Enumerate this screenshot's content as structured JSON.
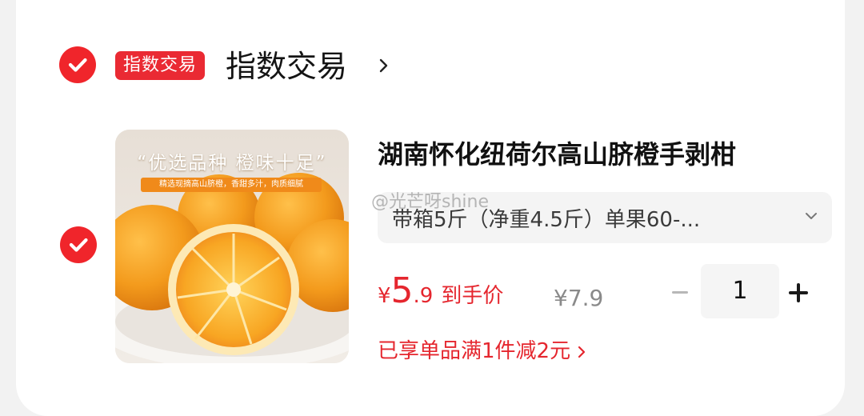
{
  "shop": {
    "tag": "指数交易",
    "name": "指数交易"
  },
  "product": {
    "title": "湖南怀化纽荷尔高山脐橙手剥柑",
    "spec": "带箱5斤（净重4.5斤）单果60-...",
    "image": {
      "headline": "“优选品种 橙味十足”",
      "subline": "精选现摘高山脐橙，香甜多汁，肉质细腻"
    }
  },
  "price": {
    "currency": "¥",
    "integer": "5",
    "decimal": ".9",
    "label": "到手价",
    "original": "¥7.9"
  },
  "quantity": "1",
  "promo": "已享单品满1件减2元",
  "watermark": "@光芒呀shine",
  "colors": {
    "accent": "#e5262e",
    "check": "#f0252b",
    "tag_bg": "#ea2a33"
  },
  "icons": {
    "select": "checkmark-circle-icon",
    "chevron": "chevron-right-icon",
    "dropdown": "chevron-down-icon",
    "minus": "minus-icon",
    "plus": "plus-icon"
  }
}
